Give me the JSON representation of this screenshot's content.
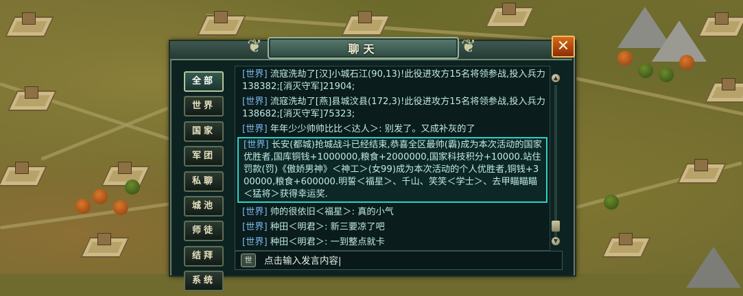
{
  "window": {
    "title": "聊天",
    "close_label": "✕"
  },
  "tabs": [
    {
      "label": "全部",
      "active": true
    },
    {
      "label": "世界",
      "active": false
    },
    {
      "label": "国家",
      "active": false
    },
    {
      "label": "军团",
      "active": false
    },
    {
      "label": "私聊",
      "active": false
    },
    {
      "label": "城池",
      "active": false
    },
    {
      "label": "师徒",
      "active": false
    },
    {
      "label": "结拜",
      "active": false
    },
    {
      "label": "系统",
      "active": false
    }
  ],
  "messages": [
    {
      "channel": "[世界]",
      "text": "流寇洗劫了[汉]小城石江(90,13)!此役进攻方15名将领参战,投入兵力138382;[消灭守军]21904;",
      "highlight": false
    },
    {
      "channel": "[世界]",
      "text": "流寇洗劫了[燕]县城汶县(172,3)!此役进攻方15名将领参战,投入兵力138682;[消灭守军]75323;",
      "highlight": false
    },
    {
      "channel": "[世界]",
      "text": "年年少少帅帅比比＜达人＞: 别发了。又成补灰的了",
      "highlight": false
    },
    {
      "channel": "[世界]",
      "text": "长安(都城)抢城战斗已经结束,恭喜全区最帅(霸)成为本次活动的国家优胜者,国库铜钱+1000000,粮食+2000000,国家科技积分+10000.站住罚款(罚)《傲娇男神》＜神工＞(女99)成为本次活动的个人优胜者,铜钱+300000,粮食+600000.明誓＜福星＞、千山、笑笑＜学士＞、去甲瞄瞄瞄＜猛将＞获得幸运奖.",
      "highlight": true
    },
    {
      "channel": "[世界]",
      "text": "帅的很依旧＜福星＞: 真的小气",
      "highlight": false
    },
    {
      "channel": "[世界]",
      "text": "种田＜明君＞: 新三要凉了吧",
      "highlight": false
    },
    {
      "channel": "[世界]",
      "text": "种田＜明君＞: 一到整点就卡",
      "highlight": false
    }
  ],
  "input": {
    "channel_label": "世",
    "value": "点击输入发言内容|"
  },
  "colors": {
    "channel_tag": "#7fb8f0",
    "message_text": "#bfeae6",
    "highlight_border": "#2fd3c4",
    "close_button": "#c4520f"
  }
}
